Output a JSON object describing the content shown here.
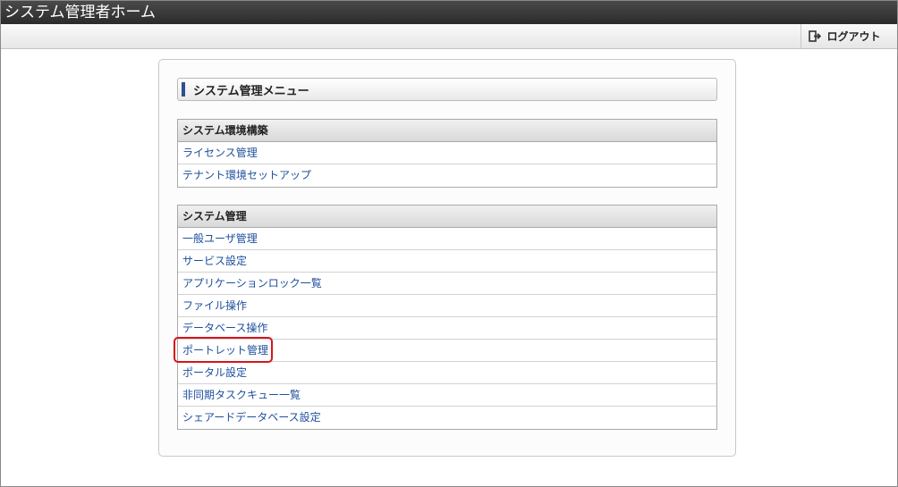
{
  "window": {
    "title": "システム管理者ホーム"
  },
  "toolbar": {
    "logout_label": "ログアウト",
    "logout_icon": "logout-icon"
  },
  "menu": {
    "title": "システム管理メニュー",
    "accent_color": "#2f4f8f"
  },
  "sections": [
    {
      "title": "システム環境構築",
      "items": [
        "ライセンス管理",
        "テナント環境セットアップ"
      ]
    },
    {
      "title": "システム管理",
      "items": [
        "一般ユーザ管理",
        "サービス設定",
        "アプリケーションロック一覧",
        "ファイル操作",
        "データベース操作",
        "ポートレット管理",
        "ポータル設定",
        "非同期タスクキュー一覧",
        "シェアードデータベース設定"
      ]
    }
  ],
  "annotation": {
    "highlight_color": "#d6141b"
  }
}
